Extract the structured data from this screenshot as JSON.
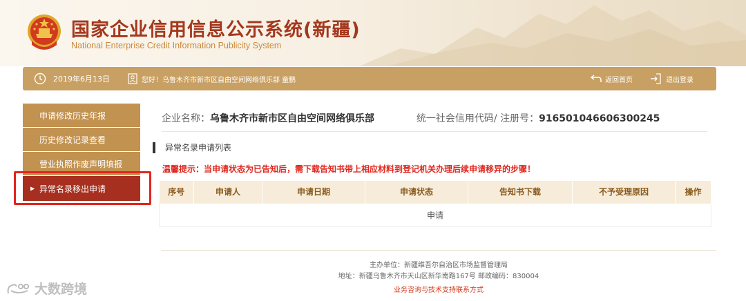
{
  "header": {
    "title_cn": "国家企业信用信息公示系统(新疆)",
    "title_en": "National Enterprise Credit Information Publicity System"
  },
  "toolbar": {
    "date": "2019年6月13日",
    "greeting": "您好！乌鲁木齐市新市区自由空间网络俱乐部 童鹏",
    "home_label": "返回首页",
    "logout_label": "退出登录"
  },
  "sidebar": {
    "items": [
      {
        "label": "申请修改历史年报"
      },
      {
        "label": "历史修改记录查看"
      },
      {
        "label": "营业执照作废声明填报"
      },
      {
        "label": "异常名录移出申请",
        "active": true
      }
    ]
  },
  "main": {
    "company_label": "企业名称：",
    "company_name": "乌鲁木齐市新市区自由空间网络俱乐部",
    "code_label": "统一社会信用代码/ 注册号：",
    "code_value": "916501046606300245",
    "section_title": "异常名录申请列表",
    "notice": "温馨提示：当申请状态为已告知后，需下载告知书带上相应材料到登记机关办理后续申请移异的步骤！",
    "table": {
      "headers": [
        "序号",
        "申请人",
        "申请日期",
        "申请状态",
        "告知书下载",
        "不予受理原因",
        "操作"
      ],
      "apply_label": "申请"
    }
  },
  "footer": {
    "organizer": "主办单位：新疆维吾尔自治区市场监督管理局",
    "address": "地址：新疆乌鲁木齐市天山区新华南路167号   邮政编码：830004",
    "support_link": "业务咨询与技术支持联系方式"
  },
  "watermark": {
    "text": "大数跨境"
  },
  "colors": {
    "brand_red": "#a3381e",
    "toolbar_gold": "#c8a063",
    "sidebar_gold": "#c29250",
    "active_red": "#a72f1f",
    "notice_red": "#e0261d",
    "highlight_red": "#e0261d"
  }
}
